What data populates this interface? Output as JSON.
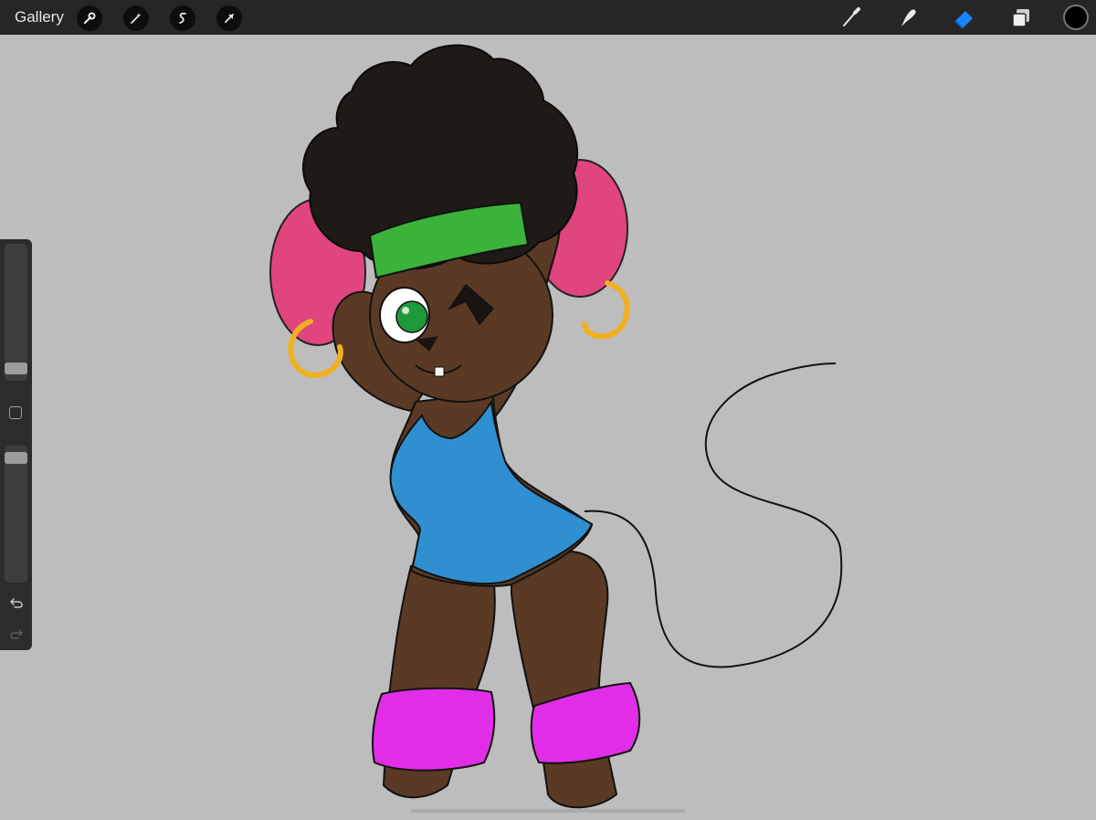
{
  "topbar": {
    "gallery_label": "Gallery",
    "left_tools": [
      "wrench-icon",
      "magic-wand-icon",
      "selection-icon",
      "transform-arrow-icon"
    ],
    "right_tools": [
      "brush-icon",
      "smudge-icon",
      "eraser-icon",
      "layers-icon"
    ],
    "active_tool": "eraser-icon",
    "current_color": "#000000"
  },
  "sidebar": {
    "brush_size_level": 0.05,
    "opacity_level": 0.95
  },
  "colors": {
    "bar": "#262626",
    "canvas": "#bdbdbd",
    "accent": "#1a84ff",
    "fur": "#5a3a24",
    "hair": "#1f1a17",
    "ears": "#e0457e",
    "headband": "#3bb33b",
    "leotard": "#2f8fd0",
    "legwarmers": "#e22de8",
    "earrings": "#f0b020",
    "eye": "#1e9a3a"
  }
}
